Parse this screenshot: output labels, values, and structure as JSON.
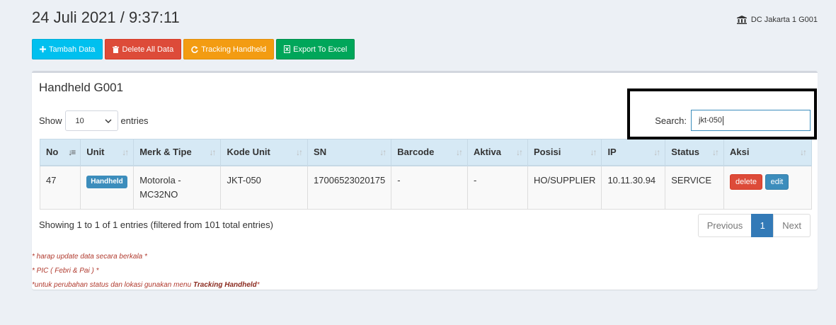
{
  "header": {
    "datetime": "24 Juli 2021 / 9:37:11",
    "location": "DC Jakarta 1 G001",
    "location_icon": "bank-icon"
  },
  "toolbar": {
    "add_label": "Tambah Data",
    "delete_all_label": "Delete All Data",
    "tracking_label": "Tracking Handheld",
    "export_label": "Export To Excel"
  },
  "box": {
    "title": "Handheld G001",
    "show_label": "Show",
    "entries_label": "entries",
    "length_value": "10",
    "search_label": "Search:",
    "search_value": "jkt-050"
  },
  "table": {
    "columns": [
      "No",
      "Unit",
      "Merk & Tipe",
      "Kode Unit",
      "SN",
      "Barcode",
      "Aktiva",
      "Posisi",
      "IP",
      "Status",
      "Aksi"
    ],
    "rows": [
      {
        "no": "47",
        "unit": "Handheld",
        "merk": "Motorola - MC32NO",
        "kode": "JKT-050",
        "sn": "17006523020175",
        "barcode": "-",
        "aktiva": "-",
        "posisi": "HO/SUPPLIER",
        "ip": "10.11.30.94",
        "status": "SERVICE",
        "delete_label": "delete",
        "edit_label": "edit"
      }
    ]
  },
  "footer": {
    "info": "Showing 1 to 1 of 1 entries (filtered from 101 total entries)",
    "prev": "Previous",
    "page": "1",
    "next": "Next"
  },
  "notes": {
    "line1": "* harap update data secara berkala *",
    "line2": "* PIC ( Febri & Pai ) *",
    "line3_prefix": "*untuk perubahan status dan lokasi gunakan menu ",
    "line3_bold": "Tracking Handheld",
    "line3_suffix": "*"
  },
  "colors": {
    "info": "#00c0ef",
    "danger": "#dd4b39",
    "warning": "#f39c12",
    "success": "#00a65a",
    "primary": "#3c8dbc"
  }
}
